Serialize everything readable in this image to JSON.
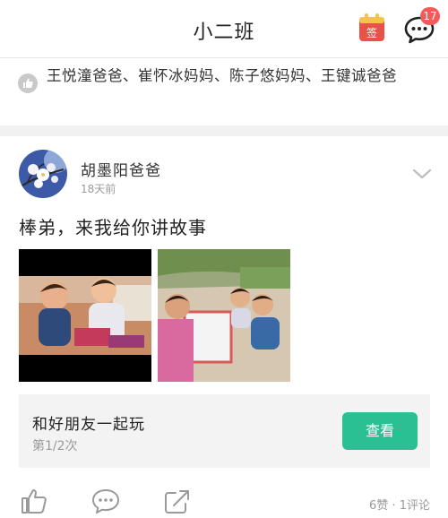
{
  "header": {
    "title": "小二班",
    "sign_label": "签",
    "message_badge": "17"
  },
  "likes": {
    "text": "王悦潼爸爸、崔怀冰妈妈、陈子悠妈妈、王键诚爸爸"
  },
  "post": {
    "author": "胡墨阳爸爸",
    "time": "18天前",
    "text": "棒弟，来我给你讲故事",
    "activity": {
      "title": "和好朋友一起玩",
      "subtitle": "第1/2次",
      "button": "查看"
    },
    "stats": "6赞 · 1评论"
  },
  "colors": {
    "accent": "#2bbf94",
    "badge": "#f35b5b",
    "sign_icon": "#e8524a"
  }
}
